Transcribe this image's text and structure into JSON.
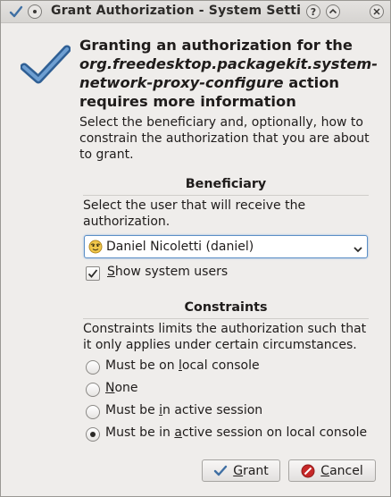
{
  "window": {
    "title": "Grant Authorization - System Setti",
    "buttons": {
      "help": "?",
      "minimize": "^"
    }
  },
  "header": {
    "heading_prefix": "Granting an authorization for the",
    "action_id_line1": "org.freedesktop.packagekit.system-",
    "action_id_line2": "network-proxy-configure",
    "heading_suffix": " action",
    "heading_line4": "requires more information",
    "subtitle": "Select the beneficiary and, optionally, how to constrain the authorization that you are about to grant."
  },
  "beneficiary": {
    "title": "Beneficiary",
    "description": "Select the user that will receive the authorization.",
    "selected_user": "Daniel Nicoletti (daniel)",
    "show_system_users": {
      "label_prefix": "",
      "label_mnemonic": "S",
      "label_rest": "how system users",
      "checked": true
    }
  },
  "constraints": {
    "title": "Constraints",
    "description": "Constraints limits the authorization such that it only applies under certain circumstances.",
    "options": [
      {
        "pre": "Must be on ",
        "mn": "l",
        "post": "ocal console",
        "selected": false
      },
      {
        "pre": "",
        "mn": "N",
        "post": "one",
        "selected": false
      },
      {
        "pre": "Must be ",
        "mn": "i",
        "post": "n active session",
        "selected": false
      },
      {
        "pre": "Must be in ",
        "mn": "a",
        "post": "ctive session on local console",
        "selected": true
      }
    ]
  },
  "actions": {
    "grant": {
      "mn": "G",
      "rest": "rant"
    },
    "cancel": {
      "mn": "C",
      "rest": "ancel"
    }
  },
  "colors": {
    "check_blue": "#3f6fa3",
    "cancel_red": "#c62828",
    "focus_blue": "#5c8fc6"
  }
}
